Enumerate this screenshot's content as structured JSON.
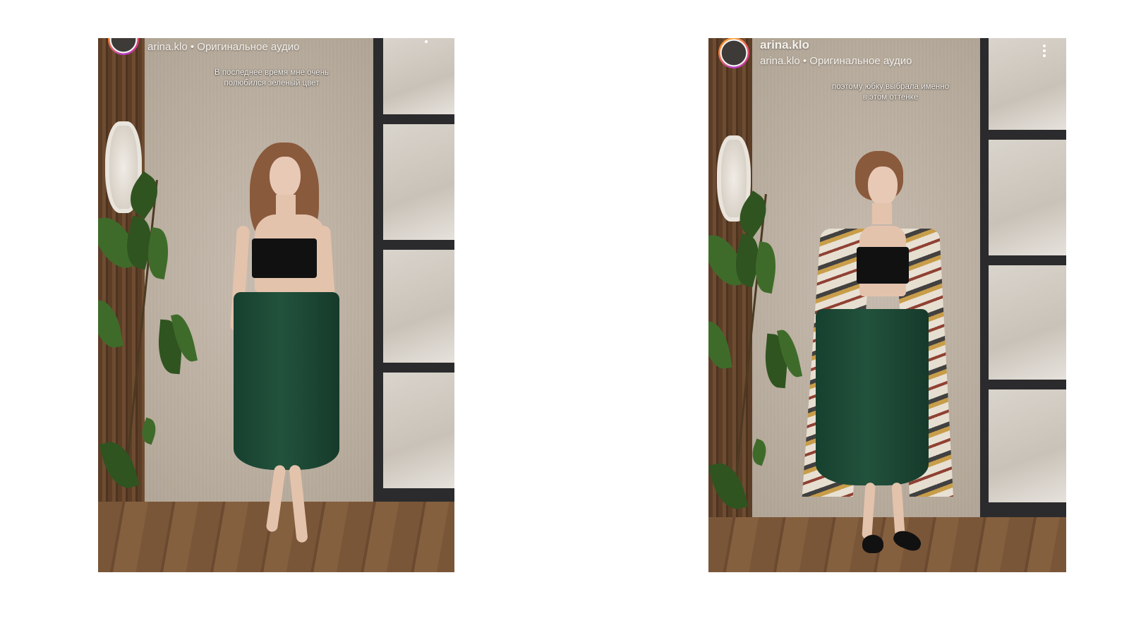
{
  "posts": [
    {
      "username": "",
      "audio_line": "arina.klo • Оригинальное аудио",
      "caption_line1": "В последнее время мне очень",
      "caption_line2": "полюбился зеленый цвет",
      "menu_icon": "more-vertical-icon"
    },
    {
      "username": "arina.klo",
      "audio_line": "arina.klo • Оригинальное аудио",
      "caption_line1": "поэтому юбку выбрала именно",
      "caption_line2": "в этом оттенке",
      "menu_icon": "more-vertical-icon"
    }
  ],
  "colors": {
    "skirt_green": "#1f4a36",
    "top_black": "#111111",
    "wall": "#b9ada0",
    "floor": "#7a5638"
  }
}
